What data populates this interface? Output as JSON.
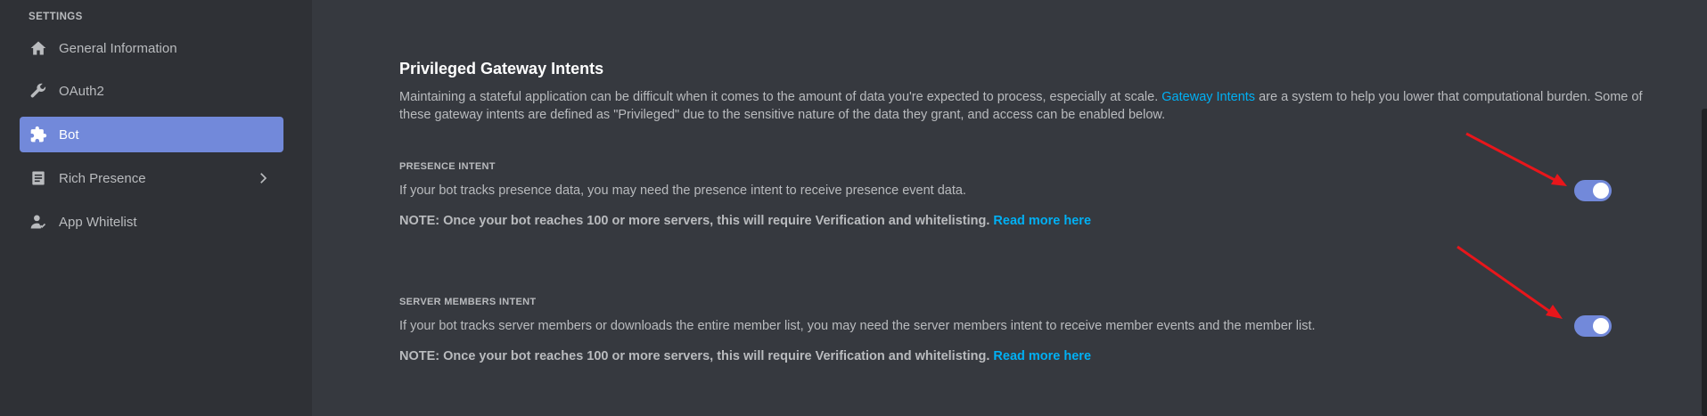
{
  "sidebar": {
    "heading": "SETTINGS",
    "items": [
      {
        "label": "General Information",
        "icon": "home-icon"
      },
      {
        "label": "OAuth2",
        "icon": "wrench-icon"
      },
      {
        "label": "Bot",
        "icon": "puzzle-icon",
        "active": true
      },
      {
        "label": "Rich Presence",
        "icon": "document-icon",
        "has_chevron": true
      },
      {
        "label": "App Whitelist",
        "icon": "user-check-icon"
      }
    ]
  },
  "main": {
    "title": "Privileged Gateway Intents",
    "description": {
      "before": "Maintaining a stateful application can be difficult when it comes to the amount of data you're expected to process, especially at scale. ",
      "link": "Gateway Intents",
      "after": " are a system to help you lower that computational burden. Some of these gateway intents are defined as \"Privileged\" due to the sensitive nature of the data they grant, and access can be enabled below."
    },
    "intents": [
      {
        "label": "PRESENCE INTENT",
        "text": "If your bot tracks presence data, you may need the presence intent to receive presence event data.",
        "note": "NOTE: Once your bot reaches 100 or more servers, this will require Verification and whitelisting.",
        "note_link": "Read more here",
        "enabled": true
      },
      {
        "label": "SERVER MEMBERS INTENT",
        "text": "If your bot tracks server members or downloads the entire member list, you may need the server members intent to receive member events and the member list.",
        "note": "NOTE: Once your bot reaches 100 or more servers, this will require Verification and whitelisting.",
        "note_link": "Read more here",
        "enabled": true
      }
    ]
  },
  "colors": {
    "sidebar_bg": "#2f3136",
    "main_bg": "#36393f",
    "accent": "#7289da",
    "link": "#00b0f4",
    "annotation_arrow": "#e8161b"
  }
}
